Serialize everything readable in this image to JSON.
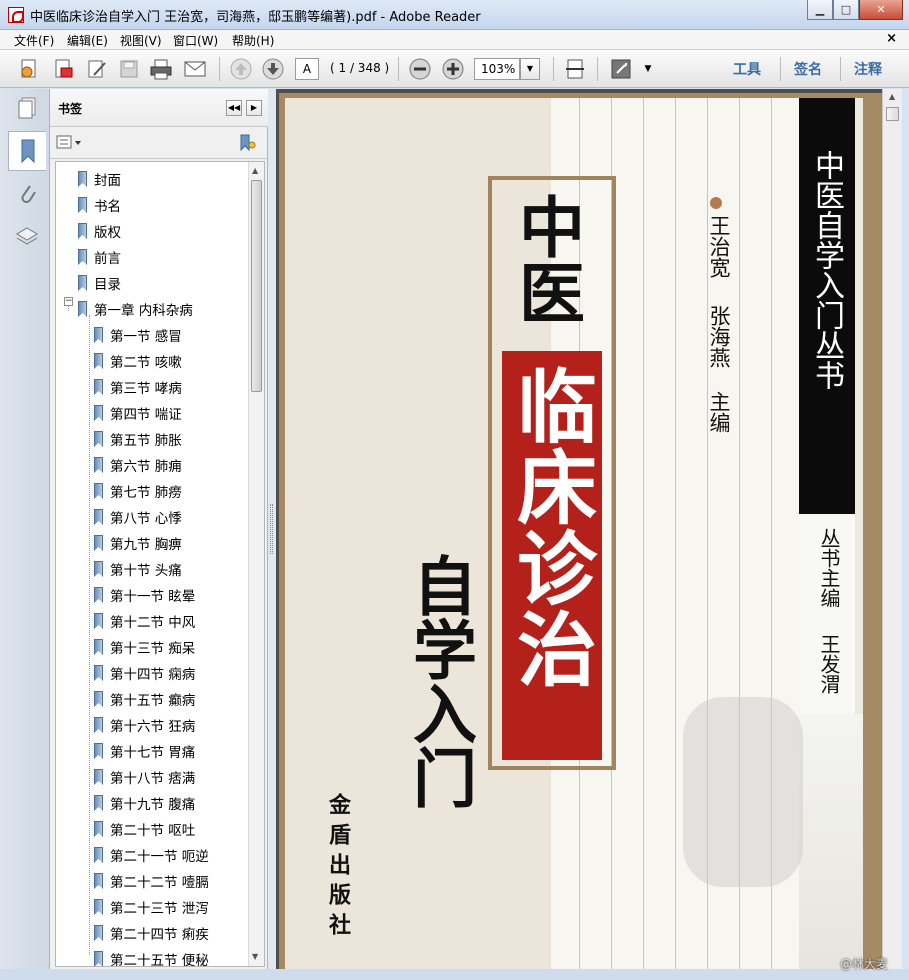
{
  "window": {
    "title": "中医临床诊治自学入门 王治宽，司海燕，邸玉鹏等编著).pdf - Adobe Reader"
  },
  "menu": [
    "文件(F)",
    "编辑(E)",
    "视图(V)",
    "窗口(W)",
    "帮助(H)"
  ],
  "toolbar": {
    "page_value": "A",
    "page_count": "( 1 / 348 )",
    "zoom": "103%",
    "links": [
      "工具",
      "签名",
      "注释"
    ]
  },
  "bookmarks_panel": {
    "title": "书签",
    "items": [
      {
        "label": "封面",
        "level": 0
      },
      {
        "label": "书名",
        "level": 0
      },
      {
        "label": "版权",
        "level": 0
      },
      {
        "label": "前言",
        "level": 0
      },
      {
        "label": "目录",
        "level": 0
      },
      {
        "label": "第一章  内科杂病",
        "level": 0,
        "expanded": true
      },
      {
        "label": "第一节  感冒",
        "level": 1
      },
      {
        "label": "第二节  咳嗽",
        "level": 1
      },
      {
        "label": "第三节  哮病",
        "level": 1
      },
      {
        "label": "第四节  喘证",
        "level": 1
      },
      {
        "label": "第五节  肺胀",
        "level": 1
      },
      {
        "label": "第六节  肺痈",
        "level": 1
      },
      {
        "label": "第七节  肺痨",
        "level": 1
      },
      {
        "label": "第八节  心悸",
        "level": 1
      },
      {
        "label": "第九节  胸痹",
        "level": 1
      },
      {
        "label": "第十节  头痛",
        "level": 1
      },
      {
        "label": "第十一节  眩晕",
        "level": 1
      },
      {
        "label": "第十二节  中风",
        "level": 1
      },
      {
        "label": "第十三节  痴呆",
        "level": 1
      },
      {
        "label": "第十四节  痫病",
        "level": 1
      },
      {
        "label": "第十五节  癫病",
        "level": 1
      },
      {
        "label": "第十六节  狂病",
        "level": 1
      },
      {
        "label": "第十七节  胃痛",
        "level": 1
      },
      {
        "label": "第十八节  痞满",
        "level": 1
      },
      {
        "label": "第十九节  腹痛",
        "level": 1
      },
      {
        "label": "第二十节  呕吐",
        "level": 1
      },
      {
        "label": "第二十一节  呃逆",
        "level": 1
      },
      {
        "label": "第二十二节  噎膈",
        "level": 1
      },
      {
        "label": "第二十三节  泄泻",
        "level": 1
      },
      {
        "label": "第二十四节  痢疾",
        "level": 1
      },
      {
        "label": "第二十五节  便秘",
        "level": 1
      }
    ]
  },
  "cover": {
    "series_title": "中医自学入门丛书",
    "series_editor_label": "丛书主编",
    "series_editor": "王发渭",
    "title_top": "中医",
    "title_red": "临床诊治",
    "title_bottom": "自学入门",
    "authors": [
      "王治宽",
      "张海燕"
    ],
    "author_role": "主编",
    "publisher": "金盾出版社"
  },
  "watermark": "@林大麦"
}
